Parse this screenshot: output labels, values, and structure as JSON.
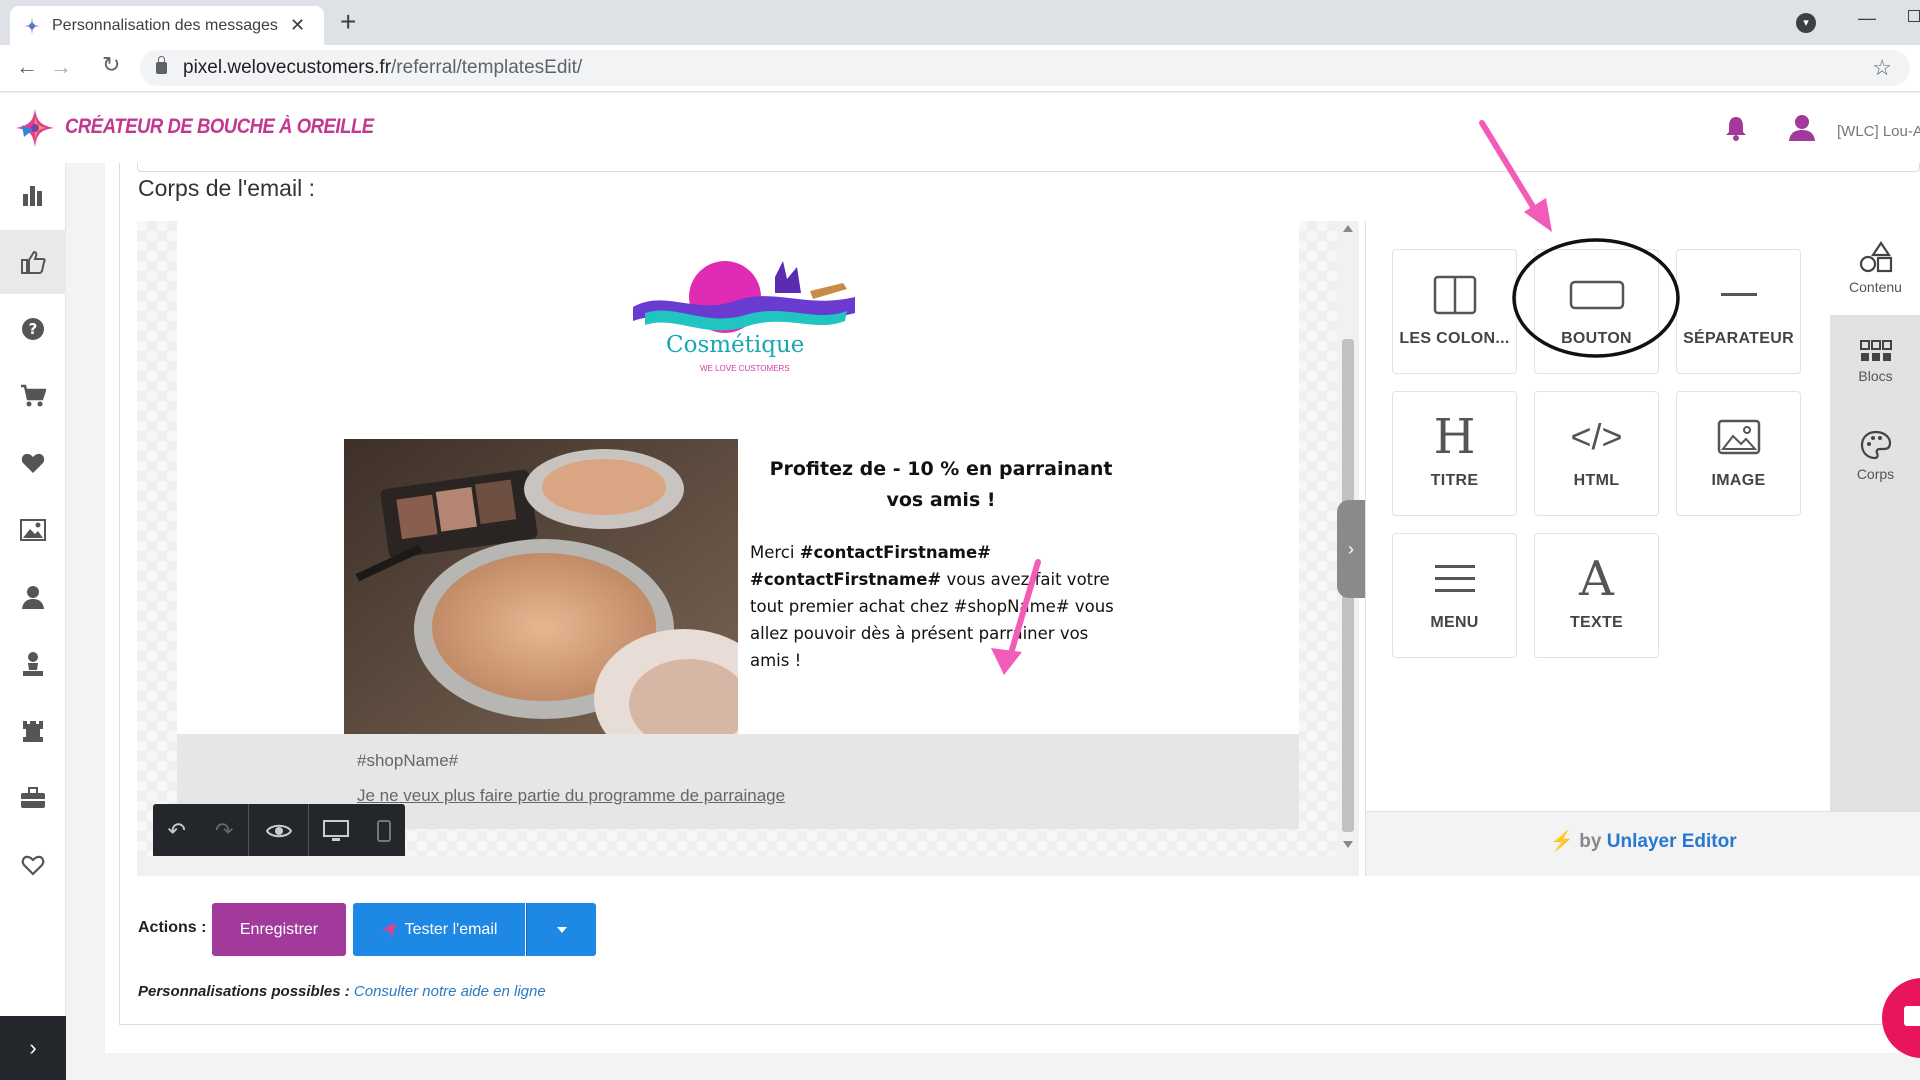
{
  "browser": {
    "tab_title": "Personnalisation des messages W",
    "tab_close": "✕",
    "new_tab": "+",
    "url_host": "pixel.welovecustomers.fr",
    "url_path": "/referral/templatesEdit/",
    "back": "←",
    "forward": "→",
    "reload": "↻",
    "bookmark": "☆"
  },
  "app": {
    "title": "CRÉATEUR DE BOUCHE À OREILLE",
    "user_name": "[WLC] Lou-A",
    "brand_color": "#c3388f"
  },
  "sidebar": {
    "items": [
      "stats-icon",
      "thumbs-up-icon",
      "help-icon",
      "cart-icon",
      "heart-icon",
      "image-icon",
      "user-icon",
      "podium-icon",
      "castle-icon",
      "briefcase-icon",
      "heart-outline-icon"
    ],
    "active_index": 1,
    "expand": "›"
  },
  "editor": {
    "section_label": "Corps de l'email :",
    "logo_word": "Cosmétique",
    "logo_sub": "WE LOVE CUSTOMERS",
    "heading": "Profitez de - 10 % en parrainant vos amis !",
    "body_merci": "Merci",
    "body_fname1": "#contactFirstname#",
    "body_fname2": "#contactFirstname#",
    "body_rest": " vous avez fait votre tout premier achat chez #shopName# vous allez pouvoir dès à présent parrainer vos amis !",
    "footer_shop": "#shopName#",
    "footer_unsub": "Je ne veux plus faire partie du programme de parrainage"
  },
  "tools": [
    {
      "label": "LES COLON...",
      "icon": "columns-icon"
    },
    {
      "label": "BOUTON",
      "icon": "button-icon"
    },
    {
      "label": "SÉPARATEUR",
      "icon": "divider-icon"
    },
    {
      "label": "TITRE",
      "icon": "heading-icon",
      "glyph": "H"
    },
    {
      "label": "HTML",
      "icon": "code-icon",
      "glyph": "</>"
    },
    {
      "label": "IMAGE",
      "icon": "image-icon"
    },
    {
      "label": "MENU",
      "icon": "menu-icon"
    },
    {
      "label": "TEXTE",
      "icon": "text-icon",
      "glyph": "A"
    }
  ],
  "panel_tabs": [
    {
      "label": "Contenu",
      "icon": "shapes-icon"
    },
    {
      "label": "Blocs",
      "icon": "blocks-icon"
    },
    {
      "label": "Corps",
      "icon": "palette-icon"
    }
  ],
  "panel_footer": {
    "by": "by",
    "brand": "Unlayer Editor"
  },
  "actions": {
    "label": "Actions :",
    "save": "Enregistrer",
    "test": "Tester l'email",
    "save_color": "#a13a9a",
    "test_color": "#1e88e5"
  },
  "help": {
    "label": "Personnalisations possibles :",
    "link": "Consulter notre aide en ligne"
  },
  "annotation_color": "#f25bb8"
}
